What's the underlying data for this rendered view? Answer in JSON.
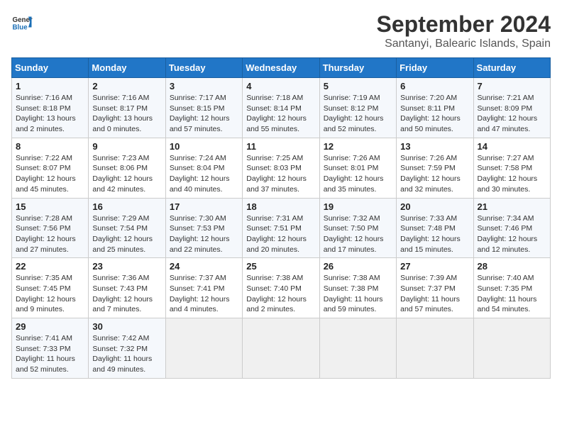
{
  "header": {
    "logo_general": "General",
    "logo_blue": "Blue",
    "title": "September 2024",
    "subtitle": "Santanyi, Balearic Islands, Spain"
  },
  "calendar": {
    "days_of_week": [
      "Sunday",
      "Monday",
      "Tuesday",
      "Wednesday",
      "Thursday",
      "Friday",
      "Saturday"
    ],
    "weeks": [
      [
        null,
        {
          "day": "2",
          "sunrise": "7:16 AM",
          "sunset": "8:17 PM",
          "daylight": "13 hours and 0 minutes."
        },
        {
          "day": "3",
          "sunrise": "7:17 AM",
          "sunset": "8:15 PM",
          "daylight": "12 hours and 57 minutes."
        },
        {
          "day": "4",
          "sunrise": "7:18 AM",
          "sunset": "8:14 PM",
          "daylight": "12 hours and 55 minutes."
        },
        {
          "day": "5",
          "sunrise": "7:19 AM",
          "sunset": "8:12 PM",
          "daylight": "12 hours and 52 minutes."
        },
        {
          "day": "6",
          "sunrise": "7:20 AM",
          "sunset": "8:11 PM",
          "daylight": "12 hours and 50 minutes."
        },
        {
          "day": "7",
          "sunrise": "7:21 AM",
          "sunset": "8:09 PM",
          "daylight": "12 hours and 47 minutes."
        }
      ],
      [
        {
          "day": "1",
          "sunrise": "7:16 AM",
          "sunset": "8:18 PM",
          "daylight": "13 hours and 2 minutes."
        },
        null,
        null,
        null,
        null,
        null,
        null
      ],
      [
        {
          "day": "8",
          "sunrise": "7:22 AM",
          "sunset": "8:07 PM",
          "daylight": "12 hours and 45 minutes."
        },
        {
          "day": "9",
          "sunrise": "7:23 AM",
          "sunset": "8:06 PM",
          "daylight": "12 hours and 42 minutes."
        },
        {
          "day": "10",
          "sunrise": "7:24 AM",
          "sunset": "8:04 PM",
          "daylight": "12 hours and 40 minutes."
        },
        {
          "day": "11",
          "sunrise": "7:25 AM",
          "sunset": "8:03 PM",
          "daylight": "12 hours and 37 minutes."
        },
        {
          "day": "12",
          "sunrise": "7:26 AM",
          "sunset": "8:01 PM",
          "daylight": "12 hours and 35 minutes."
        },
        {
          "day": "13",
          "sunrise": "7:26 AM",
          "sunset": "7:59 PM",
          "daylight": "12 hours and 32 minutes."
        },
        {
          "day": "14",
          "sunrise": "7:27 AM",
          "sunset": "7:58 PM",
          "daylight": "12 hours and 30 minutes."
        }
      ],
      [
        {
          "day": "15",
          "sunrise": "7:28 AM",
          "sunset": "7:56 PM",
          "daylight": "12 hours and 27 minutes."
        },
        {
          "day": "16",
          "sunrise": "7:29 AM",
          "sunset": "7:54 PM",
          "daylight": "12 hours and 25 minutes."
        },
        {
          "day": "17",
          "sunrise": "7:30 AM",
          "sunset": "7:53 PM",
          "daylight": "12 hours and 22 minutes."
        },
        {
          "day": "18",
          "sunrise": "7:31 AM",
          "sunset": "7:51 PM",
          "daylight": "12 hours and 20 minutes."
        },
        {
          "day": "19",
          "sunrise": "7:32 AM",
          "sunset": "7:50 PM",
          "daylight": "12 hours and 17 minutes."
        },
        {
          "day": "20",
          "sunrise": "7:33 AM",
          "sunset": "7:48 PM",
          "daylight": "12 hours and 15 minutes."
        },
        {
          "day": "21",
          "sunrise": "7:34 AM",
          "sunset": "7:46 PM",
          "daylight": "12 hours and 12 minutes."
        }
      ],
      [
        {
          "day": "22",
          "sunrise": "7:35 AM",
          "sunset": "7:45 PM",
          "daylight": "12 hours and 9 minutes."
        },
        {
          "day": "23",
          "sunrise": "7:36 AM",
          "sunset": "7:43 PM",
          "daylight": "12 hours and 7 minutes."
        },
        {
          "day": "24",
          "sunrise": "7:37 AM",
          "sunset": "7:41 PM",
          "daylight": "12 hours and 4 minutes."
        },
        {
          "day": "25",
          "sunrise": "7:38 AM",
          "sunset": "7:40 PM",
          "daylight": "12 hours and 2 minutes."
        },
        {
          "day": "26",
          "sunrise": "7:38 AM",
          "sunset": "7:38 PM",
          "daylight": "11 hours and 59 minutes."
        },
        {
          "day": "27",
          "sunrise": "7:39 AM",
          "sunset": "7:37 PM",
          "daylight": "11 hours and 57 minutes."
        },
        {
          "day": "28",
          "sunrise": "7:40 AM",
          "sunset": "7:35 PM",
          "daylight": "11 hours and 54 minutes."
        }
      ],
      [
        {
          "day": "29",
          "sunrise": "7:41 AM",
          "sunset": "7:33 PM",
          "daylight": "11 hours and 52 minutes."
        },
        {
          "day": "30",
          "sunrise": "7:42 AM",
          "sunset": "7:32 PM",
          "daylight": "11 hours and 49 minutes."
        },
        null,
        null,
        null,
        null,
        null
      ]
    ]
  }
}
